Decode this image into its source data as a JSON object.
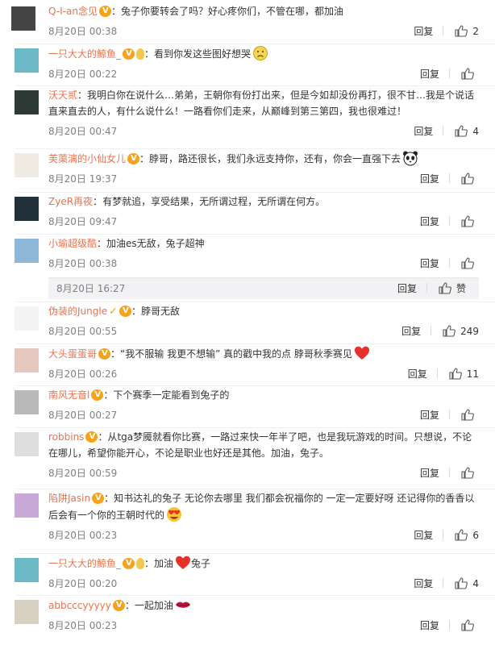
{
  "comments": [
    {
      "id": "c1",
      "name": "Q-I-an念见",
      "text": "兔子你要转会了吗？好心疼你们，不管在哪，都加油",
      "time": "8月20日 00:38",
      "reply": "回复",
      "likes": "2",
      "badges": [
        "vip"
      ],
      "emoji": "",
      "avatar_color": "#444444"
    },
    {
      "id": "c2",
      "name": "一只大大的鲸鱼_",
      "text": "看到你发这些图好想哭",
      "time": "8月20日 00:22",
      "reply": "回复",
      "likes": "",
      "badges": [
        "vip",
        "bulb"
      ],
      "emoji": "sad",
      "avatar_color": "#6cb8c4"
    },
    {
      "id": "c3",
      "name": "沃天贰",
      "text": "我明白你在说什么…弟弟，王朝你有份打出来，但是今如却没份再打，很不甘…我是个说话直来直去的人，有什么说什么！一路看你们走来，从巅峰到第三第四，我也很难过！",
      "time": "8月20日 00:47",
      "reply": "回复",
      "likes": "4",
      "badges": [],
      "emoji": "",
      "avatar_color": "#2d3a36"
    },
    {
      "id": "c4",
      "name": "芙蕖漓的小仙女儿",
      "text": "脖哥，路还很长，我们永远支持你，还有，你会一直强下去",
      "time": "8月20日 19:37",
      "reply": "回复",
      "likes": "",
      "badges": [
        "vip"
      ],
      "emoji": "panda",
      "avatar_color": "#f0ece4"
    },
    {
      "id": "c5",
      "name": "ZyeR再夜",
      "text": "有梦就追，享受结果，无所谓过程，无所谓在何方。",
      "time": "8月20日 09:47",
      "reply": "回复",
      "likes": "",
      "badges": [],
      "emoji": "",
      "avatar_color": "#22303a"
    },
    {
      "id": "c6",
      "name": "小瑜超级酷",
      "text": "加油es无敌，兔子超神",
      "time": "8月20日 00:38",
      "reply": "回复",
      "likes": "",
      "badges": [],
      "emoji": "",
      "avatar_color": "#8fb7d8"
    },
    {
      "id": "c7",
      "name": "伪装的Jungle",
      "text": "脖哥无敌",
      "time": "8月20日 00:55",
      "reply": "回复",
      "likes": "249",
      "badges": [
        "ybadge",
        "vip"
      ],
      "emoji": "",
      "avatar_color": "#f4f4f4"
    },
    {
      "id": "c8",
      "name": "大头蛋蛋哥",
      "text": "“我不服输 我更不想输” 真的戳中我的点 脖哥秋季赛见",
      "time": "8月20日 00:26",
      "reply": "回复",
      "likes": "11",
      "badges": [
        "vip"
      ],
      "emoji": "heart",
      "avatar_color": "#e7c8c0"
    },
    {
      "id": "c9",
      "name": "南风无音l",
      "text": "下个赛季一定能看到兔子的",
      "time": "8月20日 00:27",
      "reply": "回复",
      "likes": "",
      "badges": [
        "vip"
      ],
      "emoji": "",
      "avatar_color": "#b9b9b9"
    },
    {
      "id": "c10",
      "name": "robbins",
      "text": "从tga梦魇就看你比赛，一路过来快一年半了吧，也是我玩游戏的时间。只想说，不论在哪儿，希望你能开心，不论是职业也好还是其他。加油，兔子。",
      "time": "8月20日 00:59",
      "reply": "回复",
      "likes": "",
      "badges": [
        "vip"
      ],
      "emoji": "",
      "avatar_color": "#dedede"
    },
    {
      "id": "c11",
      "name": "陷阱Jasin",
      "text": "知书达礼的兔子 无论你去哪里 我们都会祝福你的 一定一定要好呀 还记得你的香香以后会有一个你的王朝时代的",
      "time": "8月20日 00:23",
      "reply": "回复",
      "likes": "6",
      "badges": [
        "vip"
      ],
      "emoji": "heart-eyes",
      "avatar_color": "#c9a9d8"
    },
    {
      "id": "c12",
      "name": "一只大大的鲸鱼_",
      "text": "加油",
      "text2": "兔子",
      "time": "8月20日 00:20",
      "reply": "回复",
      "likes": "4",
      "badges": [
        "vip",
        "bulb"
      ],
      "emoji": "heart-mid",
      "avatar_color": "#6cb8c4"
    },
    {
      "id": "c13",
      "name": "abbcccyyyyy",
      "text": "一起加油",
      "time": "8月20日 00:23",
      "reply": "回复",
      "likes": "",
      "badges": [
        "vip"
      ],
      "emoji": "lips",
      "avatar_color": "#d9d0c4"
    }
  ],
  "subreply": {
    "time": "8月20日 16:27",
    "reply": "回复",
    "like_label": "赞"
  },
  "colors": {
    "name": "#eb7350",
    "time": "#808080",
    "text": "#333333",
    "sub_bg": "#f2f2f5"
  }
}
